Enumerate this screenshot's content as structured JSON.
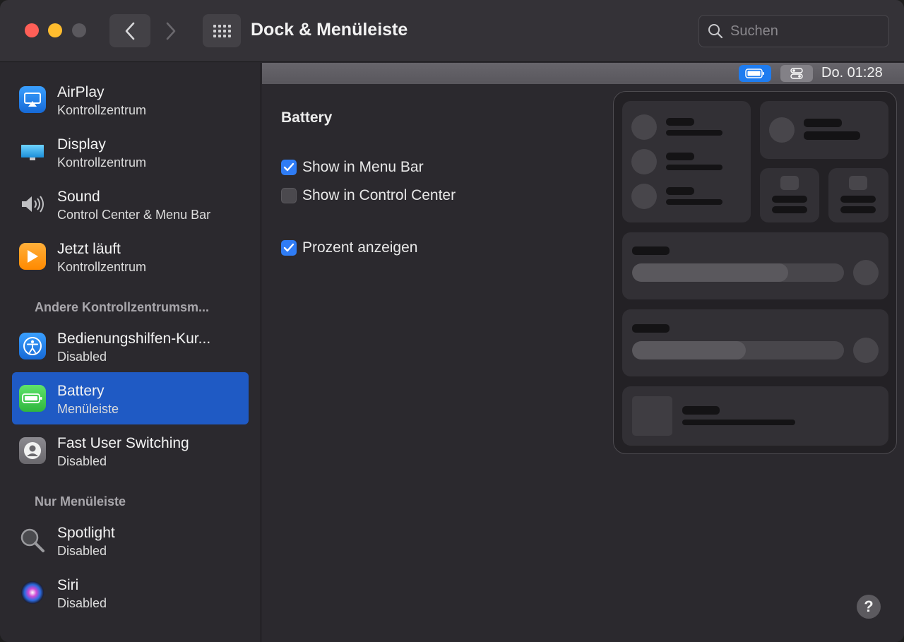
{
  "window": {
    "title": "Dock & Menüleiste",
    "search_placeholder": "Suchen"
  },
  "sidebar": {
    "items": [
      {
        "label": "AirPlay",
        "sub": "Kontrollzentrum",
        "icon": "airplay-icon"
      },
      {
        "label": "Display",
        "sub": "Kontrollzentrum",
        "icon": "display-icon"
      },
      {
        "label": "Sound",
        "sub": "Control Center & Menu Bar",
        "icon": "speaker-icon"
      },
      {
        "label": "Jetzt läuft",
        "sub": "Kontrollzentrum",
        "icon": "now-playing-icon"
      }
    ],
    "section_other": "Andere Kontrollzentrumsm...",
    "other_items": [
      {
        "label": "Bedienungshilfen-Kur...",
        "sub": "Disabled",
        "icon": "accessibility-icon"
      },
      {
        "label": "Battery",
        "sub": "Menüleiste",
        "icon": "battery-icon",
        "selected": true
      },
      {
        "label": "Fast User Switching",
        "sub": "Disabled",
        "icon": "user-icon"
      }
    ],
    "section_menubar": "Nur Menüleiste",
    "menubar_items": [
      {
        "label": "Spotlight",
        "sub": "Disabled",
        "icon": "spotlight-icon"
      },
      {
        "label": "Siri",
        "sub": "Disabled",
        "icon": "siri-icon"
      }
    ]
  },
  "main": {
    "menubar_clock": "Do. 01:28",
    "section_title": "Battery",
    "options": [
      {
        "label": "Show in Menu Bar",
        "checked": true
      },
      {
        "label": "Show in Control Center",
        "checked": false
      },
      {
        "label": "Prozent anzeigen",
        "checked": true
      }
    ],
    "help_label": "?"
  },
  "colors": {
    "accent": "#2f7cf5",
    "selection": "#1f5ac4",
    "window_bg": "#2b292e"
  }
}
